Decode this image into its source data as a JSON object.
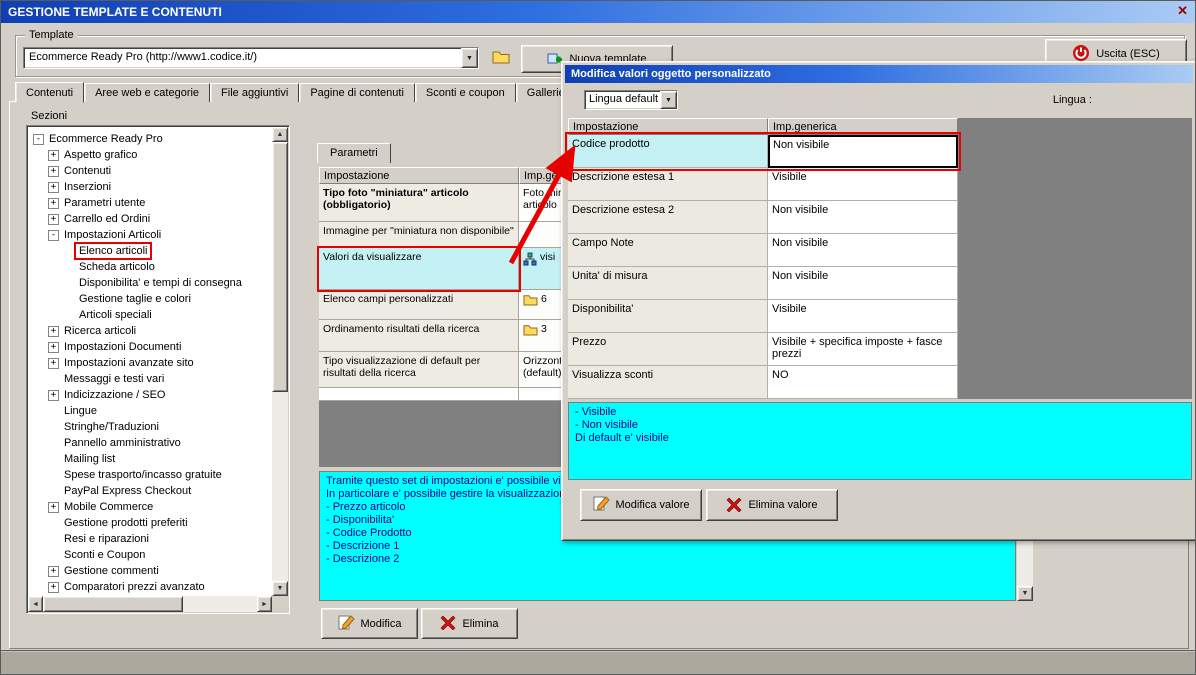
{
  "window": {
    "title": "GESTIONE TEMPLATE E CONTENUTI",
    "close_glyph": "✕"
  },
  "toolbar": {
    "group_label": "Template",
    "template_value": "Ecommerce Ready Pro (http://www1.codice.it/)",
    "new_template_label": "Nuova template",
    "exit_label": "Uscita (ESC)"
  },
  "tabs": [
    "Contenuti",
    "Aree web e categorie",
    "File aggiuntivi",
    "Pagine di contenuti",
    "Sconti e coupon",
    "Gallerie di immagini"
  ],
  "active_tab": "Contenuti",
  "sections": {
    "label": "Sezioni",
    "items": [
      {
        "label": "Ecommerce Ready Pro",
        "level": 0,
        "toggle": "-"
      },
      {
        "label": "Aspetto grafico",
        "level": 1,
        "toggle": "+"
      },
      {
        "label": "Contenuti",
        "level": 1,
        "toggle": "+"
      },
      {
        "label": "Inserzioni",
        "level": 1,
        "toggle": "+"
      },
      {
        "label": "Parametri utente",
        "level": 1,
        "toggle": "+"
      },
      {
        "label": "Carrello ed Ordini",
        "level": 1,
        "toggle": "+"
      },
      {
        "label": "Impostazioni Articoli",
        "level": 1,
        "toggle": "-"
      },
      {
        "label": "Elenco articoli",
        "level": 2,
        "highlight": true
      },
      {
        "label": "Scheda articolo",
        "level": 2
      },
      {
        "label": "Disponibilita' e tempi di consegna",
        "level": 2
      },
      {
        "label": "Gestione taglie e colori",
        "level": 2
      },
      {
        "label": "Articoli speciali",
        "level": 2
      },
      {
        "label": "Ricerca articoli",
        "level": 1,
        "toggle": "+"
      },
      {
        "label": "Impostazioni Documenti",
        "level": 1,
        "toggle": "+"
      },
      {
        "label": "Impostazioni avanzate sito",
        "level": 1,
        "toggle": "+"
      },
      {
        "label": "Messaggi e testi vari",
        "level": 1
      },
      {
        "label": "Indicizzazione / SEO",
        "level": 1,
        "toggle": "+"
      },
      {
        "label": "Lingue",
        "level": 1
      },
      {
        "label": "Stringhe/Traduzioni",
        "level": 1
      },
      {
        "label": "Pannello amministrativo",
        "level": 1
      },
      {
        "label": "Mailing list",
        "level": 1
      },
      {
        "label": "Spese trasporto/incasso gratuite",
        "level": 1
      },
      {
        "label": "PayPal Express Checkout",
        "level": 1
      },
      {
        "label": "Mobile Commerce",
        "level": 1,
        "toggle": "+"
      },
      {
        "label": "Gestione prodotti preferiti",
        "level": 1
      },
      {
        "label": "Resi e riparazioni",
        "level": 1
      },
      {
        "label": "Sconti e Coupon",
        "level": 1
      },
      {
        "label": "Gestione commenti",
        "level": 1,
        "toggle": "+"
      },
      {
        "label": "Comparatori prezzi avanzato",
        "level": 1,
        "toggle": "+"
      }
    ]
  },
  "parameters": {
    "tab_label": "Parametri",
    "columns": [
      "Impostazione",
      "Imp.gen"
    ],
    "rows": [
      {
        "name": "Tipo foto \"miniatura\" articolo (obbligatorio)",
        "value": "Foto min\narticolo",
        "bold": true
      },
      {
        "name": "Immagine per \"miniatura non disponibile\"",
        "value": ""
      },
      {
        "name": "Valori da visualizzare",
        "value": "visi",
        "icon": "sitemap",
        "highlight": true
      },
      {
        "name": "Elenco campi personalizzati",
        "value": "6",
        "icon": "folder"
      },
      {
        "name": "Ordinamento risultati della ricerca",
        "value": "3",
        "icon": "folder"
      },
      {
        "name": "Tipo visualizzazione di default per risultati della ricerca",
        "value": "Orizzont\n(default)"
      }
    ],
    "info_lines": [
      "Tramite questo set di impostazioni e' possibile visua",
      "In particolare e' possibile gestire la visualizzazione",
      "- Prezzo articolo",
      "- Disponibilita'",
      "- Codice Prodotto",
      "- Descrizione 1",
      "- Descrizione 2"
    ],
    "modify_label": "Modifica",
    "delete_label": "Elimina"
  },
  "dialog": {
    "title": "Modifica valori oggetto personalizzato",
    "language_label": "Lingua :",
    "language_value": "Lingua default",
    "columns": [
      "Impostazione",
      "Imp.generica"
    ],
    "rows": [
      {
        "name": "Codice prodotto",
        "value": "Non visibile",
        "highlight": true
      },
      {
        "name": "Descrizione estesa 1",
        "value": "Visibile"
      },
      {
        "name": "Descrizione estesa 2",
        "value": "Non visibile"
      },
      {
        "name": "Campo Note",
        "value": "Non visibile"
      },
      {
        "name": "Unita' di misura",
        "value": "Non visibile"
      },
      {
        "name": "Disponibilita'",
        "value": "Visibile"
      },
      {
        "name": "Prezzo",
        "value": "Visibile + specifica imposte + fasce prezzi"
      },
      {
        "name": "Visualizza sconti",
        "value": "NO"
      }
    ],
    "info_lines": [
      "- Visibile",
      "- Non visibile",
      "Di default e' visibile"
    ],
    "modify_label": "Modifica valore",
    "delete_label": "Elimina valore"
  },
  "icons": {
    "combo_arrow": "▼",
    "scroll_up": "▲",
    "scroll_down": "▼",
    "scroll_left": "◄",
    "scroll_right": "►"
  },
  "colors": {
    "highlight_cyan": "#c4f2f4",
    "info_cyan": "#00ffff",
    "annotation_red": "#e60000"
  }
}
